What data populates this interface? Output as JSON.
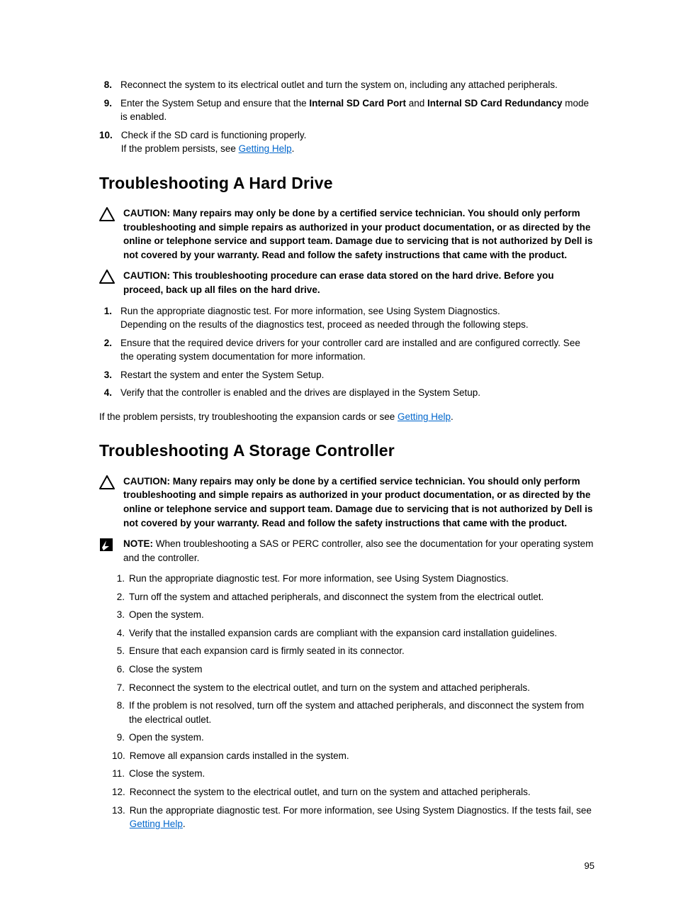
{
  "top_list": {
    "items": [
      {
        "num": "8.",
        "text": "Reconnect the system to its electrical outlet and turn the system on, including any attached peripherals."
      },
      {
        "num": "9.",
        "pre": "Enter the System Setup and ensure that the ",
        "b1": "Internal SD Card Port",
        "mid": " and ",
        "b2": "Internal SD Card Redundancy",
        "post": " mode is enabled."
      },
      {
        "num": "10.",
        "line1": "Check if the SD card is functioning properly.",
        "line2_pre": "If the problem persists, see ",
        "link": "Getting Help",
        "line2_post": "."
      }
    ]
  },
  "hd": {
    "heading": "Troubleshooting A Hard Drive",
    "caution1": "CAUTION: Many repairs may only be done by a certified service technician. You should only perform troubleshooting and simple repairs as authorized in your product documentation, or as directed by the online or telephone service and support team. Damage due to servicing that is not authorized by Dell is not covered by your warranty. Read and follow the safety instructions that came with the product.",
    "caution2": "CAUTION: This troubleshooting procedure can erase data stored on the hard drive. Before you proceed, back up all files on the hard drive.",
    "steps": [
      {
        "num": "1.",
        "line1": "Run the appropriate diagnostic test. For more information, see Using System Diagnostics.",
        "line2": "Depending on the results of the diagnostics test, proceed as needed through the following steps."
      },
      {
        "num": "2.",
        "text": "Ensure that the required device drivers for your controller card are installed and are configured correctly. See the operating system documentation for more information."
      },
      {
        "num": "3.",
        "text": "Restart the system and enter the System Setup."
      },
      {
        "num": "4.",
        "text": "Verify that the controller is enabled and the drives are displayed in the System Setup."
      }
    ],
    "after_pre": "If the problem persists, try troubleshooting the expansion cards or see ",
    "after_link": "Getting Help",
    "after_post": "."
  },
  "sc": {
    "heading": "Troubleshooting A Storage Controller",
    "caution": "CAUTION: Many repairs may only be done by a certified service technician. You should only perform troubleshooting and simple repairs as authorized in your product documentation, or as directed by the online or telephone service and support team. Damage due to servicing that is not authorized by Dell is not covered by your warranty. Read and follow the safety instructions that came with the product.",
    "note_prefix": "NOTE: ",
    "note": "When troubleshooting a SAS or PERC controller, also see the documentation for your operating system and the controller.",
    "steps": [
      {
        "num": "1.",
        "text": "Run the appropriate diagnostic test. For more information, see Using System Diagnostics."
      },
      {
        "num": "2.",
        "text": "Turn off the system and attached peripherals, and disconnect the system from the electrical outlet."
      },
      {
        "num": "3.",
        "text": "Open the system."
      },
      {
        "num": "4.",
        "text": "Verify that the installed expansion cards are compliant with the expansion card installation guidelines."
      },
      {
        "num": "5.",
        "text": "Ensure that each expansion card is firmly seated in its connector."
      },
      {
        "num": "6.",
        "text": "Close the system"
      },
      {
        "num": "7.",
        "text": "Reconnect the system to the electrical outlet, and turn on the system and attached peripherals."
      },
      {
        "num": "8.",
        "text": "If the problem is not resolved, turn off the system and attached peripherals, and disconnect the system from the electrical outlet."
      },
      {
        "num": "9.",
        "text": "Open the system."
      },
      {
        "num": "10.",
        "text": "Remove all expansion cards installed in the system."
      },
      {
        "num": "11.",
        "text": "Close the system."
      },
      {
        "num": "12.",
        "text": "Reconnect the system to the electrical outlet, and turn on the system and attached peripherals."
      },
      {
        "num": "13.",
        "pre": "Run the appropriate diagnostic test. For more information, see Using System Diagnostics. If the tests fail, see ",
        "link": "Getting Help",
        "post": "."
      }
    ]
  },
  "page_number": "95"
}
